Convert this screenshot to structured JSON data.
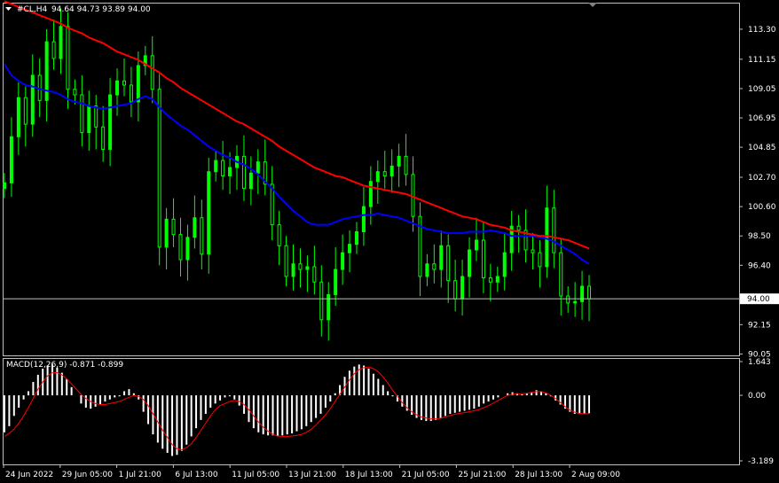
{
  "header": {
    "symbol": "#CL,H4",
    "ohlc": "94.64 94.73 93.89 94.00"
  },
  "price_axis": {
    "ticks": [
      "113.30",
      "111.15",
      "109.05",
      "106.95",
      "104.85",
      "102.70",
      "100.60",
      "98.50",
      "96.40",
      "94.00",
      "92.15",
      "90.05"
    ],
    "current": "94.00"
  },
  "macd": {
    "label": "MACD(12,26,9) -0.871 -0.899",
    "ticks": [
      "1.643",
      "0.00",
      "-3.189"
    ]
  },
  "time_axis": {
    "ticks": [
      "24 Jun 2022",
      "29 Jun 05:00",
      "1 Jul 21:00",
      "6 Jul 13:00",
      "11 Jul 05:00",
      "13 Jul 21:00",
      "18 Jul 13:00",
      "21 Jul 05:00",
      "25 Jul 21:00",
      "28 Jul 13:00",
      "2 Aug 09:00"
    ]
  },
  "colors": {
    "background": "#000000",
    "frame": "#c0c0c0",
    "candle": "#00ff00",
    "ma_slow": "#ff0000",
    "ma_fast": "#0000ff",
    "histogram": "#ffffff",
    "signal": "#ff0000",
    "price_line": "#c0c0c0"
  },
  "chart_data": [
    {
      "type": "line",
      "title": "#CL,H4",
      "ylim": [
        90.05,
        115.2
      ],
      "close": [
        102.3,
        105.6,
        108.4,
        106.5,
        110.0,
        108.2,
        112.4,
        111.2,
        113.5,
        109.0,
        108.6,
        105.9,
        107.8,
        106.3,
        104.7,
        108.6,
        109.6,
        109.3,
        108.1,
        110.7,
        111.4,
        109.0,
        97.7,
        99.7,
        98.6,
        96.8,
        98.4,
        99.8,
        97.2,
        103.1,
        103.9,
        102.8,
        103.4,
        104.2,
        101.9,
        103.0,
        103.8,
        102.2,
        99.3,
        97.8,
        95.6,
        96.5,
        96.1,
        96.3,
        95.2,
        92.5,
        94.3,
        96.1,
        97.3,
        97.9,
        98.8,
        100.6,
        102.4,
        103.1,
        102.8,
        103.5,
        104.2,
        102.9,
        99.9,
        95.6,
        96.5,
        96.1,
        97.8,
        95.3,
        94.0,
        95.6,
        97.5,
        98.2,
        95.5,
        95.2,
        95.6,
        97.3,
        99.2,
        98.9,
        97.5,
        97.3,
        96.3,
        100.5,
        97.3,
        94.2,
        93.7,
        93.8,
        94.9,
        94.0
      ],
      "series": [
        {
          "name": "",
          "values": [
            110.8,
            110.0,
            109.6,
            109.3,
            109.2,
            109.0,
            108.9,
            108.8,
            108.6,
            108.3,
            108.1,
            108.0,
            107.8,
            107.7,
            107.6,
            107.7,
            107.8,
            107.9,
            108.0,
            108.3,
            108.5,
            108.3,
            107.7,
            107.2,
            106.8,
            106.4,
            106.1,
            105.7,
            105.3,
            104.9,
            104.6,
            104.3,
            104.1,
            103.8,
            103.6,
            103.3,
            102.9,
            102.4,
            101.9,
            101.3,
            100.8,
            100.3,
            99.9,
            99.5,
            99.3,
            99.3,
            99.3,
            99.5,
            99.7,
            99.8,
            99.9,
            100.0,
            100.0,
            100.1,
            100.0,
            99.9,
            99.8,
            99.6,
            99.4,
            99.2,
            99.0,
            98.9,
            98.8,
            98.7,
            98.7,
            98.7,
            98.8,
            98.8,
            98.8,
            98.9,
            98.8,
            98.7,
            98.5,
            98.5,
            98.5,
            98.5,
            98.4,
            98.3,
            98.1,
            97.8,
            97.5,
            97.2,
            96.8,
            96.5
          ]
        },
        {
          "name": "",
          "values": [
            115.3,
            115.1,
            114.9,
            114.7,
            114.5,
            114.3,
            114.1,
            113.9,
            113.7,
            113.4,
            113.2,
            113.0,
            112.7,
            112.5,
            112.3,
            112.0,
            111.7,
            111.5,
            111.3,
            111.1,
            110.8,
            110.5,
            110.2,
            109.8,
            109.5,
            109.1,
            108.8,
            108.5,
            108.2,
            107.9,
            107.6,
            107.3,
            107.0,
            106.7,
            106.5,
            106.2,
            105.9,
            105.6,
            105.3,
            104.9,
            104.6,
            104.3,
            104.0,
            103.7,
            103.4,
            103.2,
            103.0,
            102.8,
            102.7,
            102.5,
            102.3,
            102.1,
            102.0,
            101.9,
            101.8,
            101.7,
            101.6,
            101.5,
            101.3,
            101.1,
            100.9,
            100.7,
            100.5,
            100.3,
            100.1,
            99.9,
            99.8,
            99.7,
            99.5,
            99.3,
            99.2,
            99.1,
            98.9,
            98.8,
            98.7,
            98.6,
            98.5,
            98.5,
            98.4,
            98.3,
            98.2,
            98.0,
            97.8,
            97.6
          ]
        }
      ]
    },
    {
      "type": "bar",
      "title": "MACD(12,26,9) -0.871 -0.899",
      "ylim": [
        -3.189,
        1.643
      ],
      "values": [
        -1.8,
        -1.5,
        -1.0,
        -0.6,
        -0.2,
        0.2,
        0.65,
        1.0,
        1.3,
        1.45,
        1.5,
        1.35,
        1.1,
        0.8,
        0.4,
        0.0,
        -0.4,
        -0.6,
        -0.65,
        -0.55,
        -0.45,
        -0.3,
        -0.2,
        -0.1,
        -0.05,
        0.2,
        0.3,
        0.1,
        -0.2,
        -0.8,
        -1.4,
        -1.9,
        -2.3,
        -2.6,
        -2.8,
        -2.95,
        -2.9,
        -2.7,
        -2.4,
        -2.0,
        -1.6,
        -1.2,
        -0.9,
        -0.6,
        -0.4,
        -0.25,
        -0.1,
        -0.05,
        -0.2,
        -0.5,
        -0.9,
        -1.3,
        -1.6,
        -1.8,
        -1.9,
        -1.95,
        -1.95,
        -2.0,
        -1.95,
        -1.9,
        -1.85,
        -1.75,
        -1.65,
        -1.5,
        -1.3,
        -1.1,
        -0.9,
        -0.6,
        -0.3,
        0.1,
        0.5,
        0.9,
        1.2,
        1.4,
        1.5,
        1.45,
        1.3,
        1.05,
        0.8,
        0.5,
        0.2,
        -0.05,
        -0.3,
        -0.55,
        -0.75,
        -0.95,
        -1.1,
        -1.2,
        -1.25,
        -1.25,
        -1.2,
        -1.1,
        -1.0,
        -0.9,
        -0.85,
        -0.8,
        -0.75,
        -0.7,
        -0.65,
        -0.55,
        -0.4,
        -0.3,
        -0.2,
        -0.1,
        0.0,
        0.1,
        0.15,
        0.1,
        0.05,
        0.1,
        0.15,
        0.25,
        0.2,
        0.1,
        -0.05,
        -0.25,
        -0.45,
        -0.65,
        -0.8,
        -0.9,
        -0.9,
        -0.88,
        -0.871
      ],
      "series": [
        {
          "name": "",
          "values": [
            -2.0,
            -1.85,
            -1.65,
            -1.35,
            -1.0,
            -0.6,
            -0.15,
            0.3,
            0.65,
            0.95,
            1.1,
            1.1,
            1.0,
            0.8,
            0.55,
            0.3,
            0.05,
            -0.15,
            -0.3,
            -0.4,
            -0.45,
            -0.45,
            -0.4,
            -0.35,
            -0.3,
            -0.2,
            -0.1,
            0.0,
            -0.05,
            -0.2,
            -0.5,
            -0.9,
            -1.3,
            -1.7,
            -2.05,
            -2.4,
            -2.6,
            -2.65,
            -2.55,
            -2.35,
            -2.05,
            -1.7,
            -1.35,
            -1.0,
            -0.7,
            -0.5,
            -0.4,
            -0.3,
            -0.25,
            -0.3,
            -0.45,
            -0.7,
            -1.0,
            -1.3,
            -1.55,
            -1.75,
            -1.9,
            -1.98,
            -2.0,
            -2.0,
            -1.98,
            -1.95,
            -1.9,
            -1.8,
            -1.65,
            -1.45,
            -1.2,
            -0.95,
            -0.65,
            -0.3,
            0.05,
            0.4,
            0.75,
            1.05,
            1.25,
            1.35,
            1.38,
            1.3,
            1.15,
            0.9,
            0.6,
            0.25,
            -0.05,
            -0.35,
            -0.6,
            -0.8,
            -0.95,
            -1.05,
            -1.1,
            -1.15,
            -1.15,
            -1.12,
            -1.05,
            -0.98,
            -0.92,
            -0.88,
            -0.84,
            -0.8,
            -0.75,
            -0.7,
            -0.6,
            -0.5,
            -0.38,
            -0.25,
            -0.12,
            0.0,
            0.05,
            0.08,
            0.08,
            0.1,
            0.14,
            0.18,
            0.18,
            0.12,
            0.0,
            -0.15,
            -0.35,
            -0.55,
            -0.72,
            -0.82,
            -0.88,
            -0.9,
            -0.899
          ]
        }
      ]
    }
  ]
}
